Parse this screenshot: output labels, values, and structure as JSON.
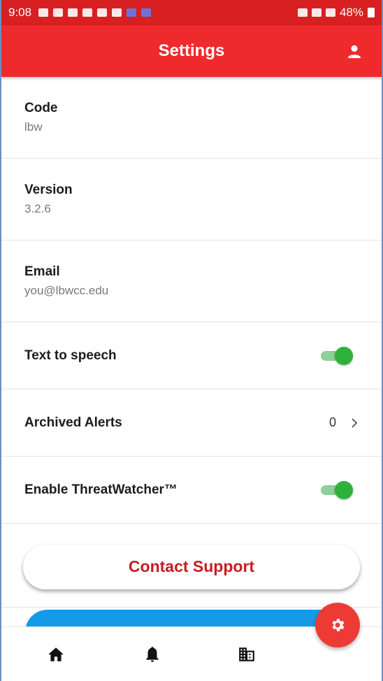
{
  "status_bar": {
    "time": "9:08",
    "battery": "48%"
  },
  "header": {
    "title": "Settings"
  },
  "info_rows": [
    {
      "label": "Code",
      "value": "lbw"
    },
    {
      "label": "Version",
      "value": "3.2.6"
    },
    {
      "label": "Email",
      "value": "you@lbwcc.edu"
    }
  ],
  "options": {
    "text_to_speech": {
      "label": "Text to speech",
      "enabled": true
    },
    "archived_alerts": {
      "label": "Archived Alerts",
      "count": "0"
    },
    "threatwatcher": {
      "label": "Enable ThreatWatcher™",
      "enabled": true
    }
  },
  "contact_support_label": "Contact Support",
  "icons": {
    "profile": "person-icon",
    "home": "home-icon",
    "alerts": "bell-icon",
    "buildings": "building-icon",
    "fab": "gear-icon"
  },
  "colors": {
    "header": "#ee2a2c",
    "status_bar": "#d81f22",
    "toggle_on": "#2eb13b",
    "support_text": "#c71d22",
    "primary_button": "#159ae8",
    "fab": "#ee3a34"
  }
}
